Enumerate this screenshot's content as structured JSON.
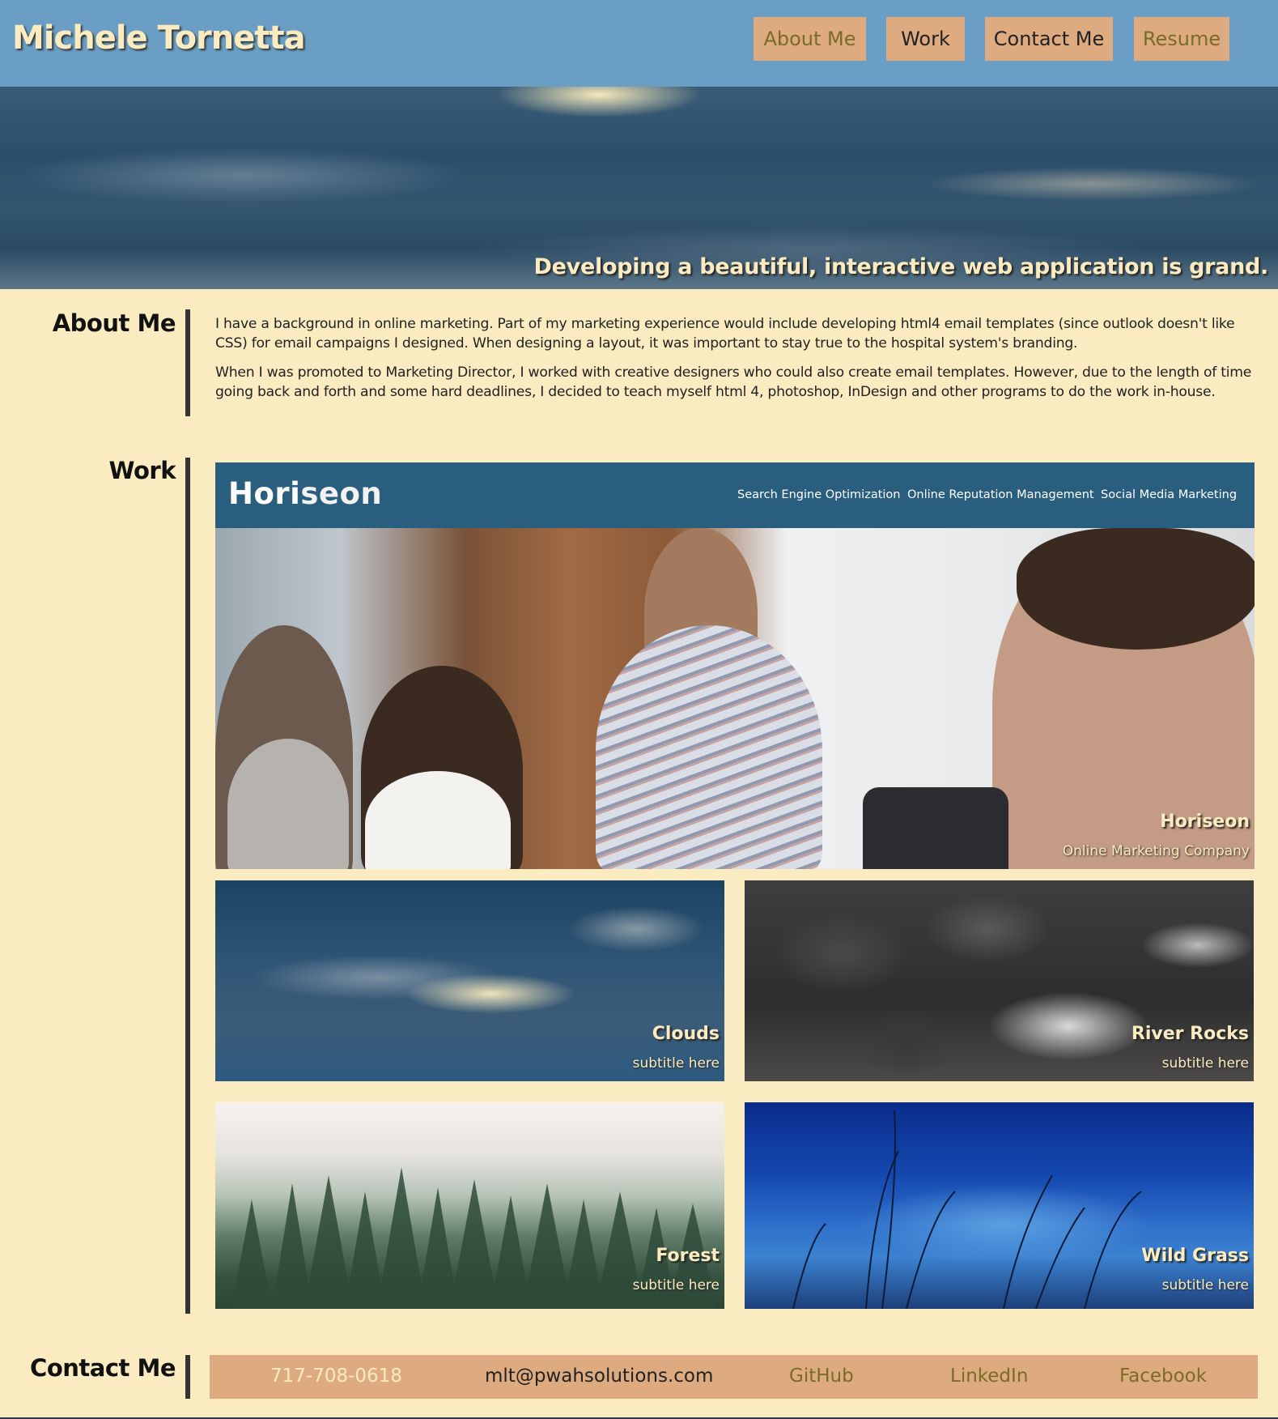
{
  "header": {
    "site_title": "Michele Tornetta",
    "nav": {
      "about": "About Me",
      "work": "Work",
      "contact": "Contact Me",
      "resume": "Resume"
    }
  },
  "hero": {
    "tagline": "Developing a beautiful, interactive web application is grand."
  },
  "about": {
    "title": "About Me",
    "paragraphs": [
      "I have a background in online marketing. Part of my marketing experience would include developing html4 email templates (since outlook doesn't like CSS) for email campaigns I designed. When designing a layout, it was important to stay true to the hospital system's branding.",
      "When I was promoted to Marketing Director, I worked with creative designers who could also create email templates. However, due to the length of time going back and forth and some hard deadlines, I decided to teach myself html 4, photoshop, InDesign and other programs to do the work in-house."
    ]
  },
  "work": {
    "title": "Work",
    "featured": {
      "logo_main": "Hori",
      "logo_accent": "seon",
      "nav": [
        "Search Engine Optimization",
        "Online Reputation Management",
        "Social Media Marketing"
      ],
      "title": "Horiseon",
      "subtitle": "Online Marketing Company"
    },
    "tiles": [
      {
        "title": "Clouds",
        "subtitle": "subtitle here"
      },
      {
        "title": "River Rocks",
        "subtitle": "subtitle here"
      },
      {
        "title": "Forest",
        "subtitle": "subtitle here"
      },
      {
        "title": "Wild Grass",
        "subtitle": "subtitle here"
      }
    ]
  },
  "contact": {
    "title": "Contact Me",
    "phone": "717-708-0618",
    "email": "mlt@pwahsolutions.com",
    "github": "GitHub",
    "linkedin": "LinkedIn",
    "facebook": "Facebook"
  },
  "colors": {
    "header_bg": "#6a9ec4",
    "page_bg": "#faebc0",
    "button_bg": "#deab81",
    "accent_text": "#7a6b28",
    "horiseon_bar": "#2a5e7e"
  }
}
